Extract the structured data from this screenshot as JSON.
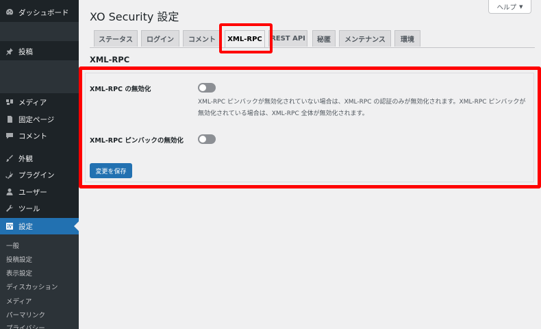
{
  "sidebar": {
    "dashboard": "ダッシュボード",
    "posts": "投稿",
    "media": "メディア",
    "pages": "固定ページ",
    "comments": "コメント",
    "appearance": "外観",
    "plugins": "プラグイン",
    "users": "ユーザー",
    "tools": "ツール",
    "settings": "設定",
    "submenu": [
      "一般",
      "投稿設定",
      "表示設定",
      "ディスカッション",
      "メディア",
      "パーマリンク",
      "プライバシー"
    ]
  },
  "page": {
    "title": "XO Security 設定",
    "help_label": "ヘルプ",
    "help_caret": "▼"
  },
  "tabs": [
    "ステータス",
    "ログイン",
    "コメント",
    "XML-RPC",
    "REST API",
    "秘匿",
    "メンテナンス",
    "環境"
  ],
  "section": {
    "title": "XML-RPC",
    "fields": [
      {
        "label": "XML-RPC の無効化",
        "enabled": false,
        "description": "XML-RPC ピンバックが無効化されていない場合は、XML-RPC の認証のみが無効化されます。XML-RPC ピンバックが無効化されている場合は、XML-RPC 全体が無効化されます。"
      },
      {
        "label": "XML-RPC ピンバックの無効化",
        "enabled": false
      }
    ],
    "save_label": "変更を保存"
  },
  "colors": {
    "sidebar_bg": "#1d2327",
    "accent": "#2271b1",
    "highlight": "#ff0000",
    "page_bg": "#f0f0f1"
  }
}
